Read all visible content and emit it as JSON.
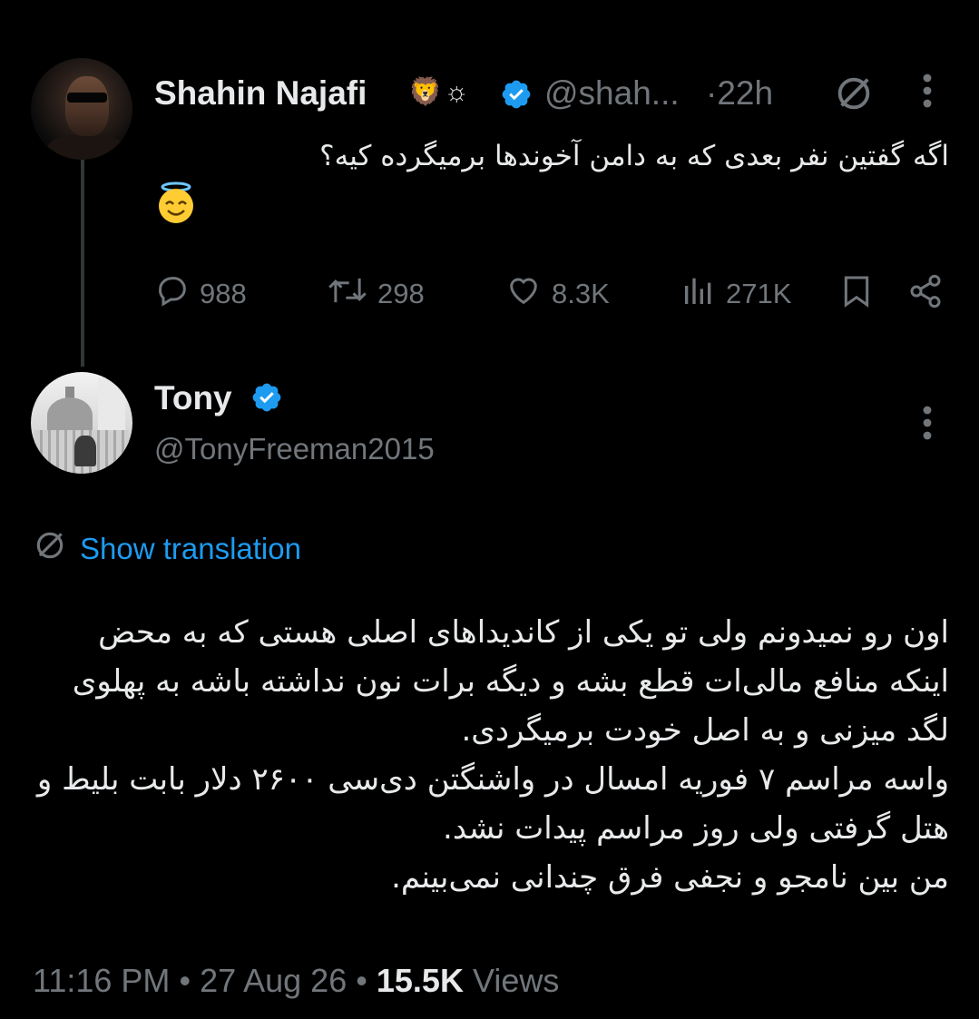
{
  "parent_tweet": {
    "author_name": "Shahin Najafi",
    "author_emblem": "🦁☼",
    "verified": true,
    "handle": "@shah...",
    "separator": "·",
    "time_ago": "22h",
    "text": "اگه گفتین نفر بعدی که به دامن آخوندها برمیگرده کیه؟",
    "emoji": "😇",
    "actions": {
      "replies": "988",
      "retweets": "298",
      "likes": "8.3K",
      "views": "271K"
    }
  },
  "reply_tweet": {
    "author_name": "Tony",
    "verified": true,
    "handle": "@TonyFreeman2015",
    "show_translation_label": "Show translation",
    "text": "اون رو نمیدونم ولی تو یکی از کاندیداهای اصلی هستی که به محض اینکه منافع مالی‌ات قطع بشه و دیگه برات نون نداشته باشه به پهلوی لگد میزنی و به اصل خودت برمیگردی.\nواسه مراسم ۷ فوریه امسال در واشنگتن دی‌سی ۲۶۰۰ دلار بابت بلیط و هتل گرفتی ولی روز مراسم پیدات نشد.\nمن بین نامجو و نجفی فرق چندانی نمی‌بینم.",
    "time": "11:16 PM",
    "dot": "•",
    "date": "27 Aug 26",
    "views_count": "15.5K",
    "views_label": "Views"
  },
  "colors": {
    "background": "#000000",
    "text_primary": "#e7e9ea",
    "text_muted": "#71767b",
    "accent_blue": "#1d9bf0",
    "thread_line": "#333639"
  },
  "icons": {
    "verified": "verified-badge-icon",
    "grok": "grok-icon",
    "more": "more-dots-icon",
    "reply": "reply-bubble-icon",
    "retweet": "retweet-icon",
    "like": "heart-icon",
    "views": "views-bars-icon",
    "bookmark": "bookmark-icon",
    "share": "share-icon",
    "translate": "translate-icon"
  }
}
